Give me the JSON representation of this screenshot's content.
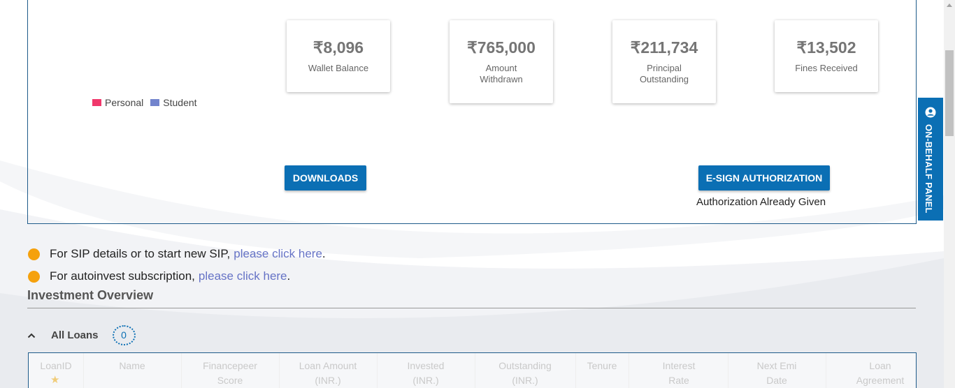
{
  "chart_data": {
    "type": "pie",
    "legend": [
      {
        "label": "Personal",
        "color": "#f0386b"
      },
      {
        "label": "Student",
        "color": "#7284cd"
      }
    ]
  },
  "stats": [
    {
      "value": "₹8,096",
      "label": "Wallet Balance"
    },
    {
      "value": "₹765,000",
      "label": "Amount Withdrawn"
    },
    {
      "value": "₹211,734",
      "label": "Principal Outstanding"
    },
    {
      "value": "₹13,502",
      "label": "Fines Received"
    }
  ],
  "buttons": {
    "downloads": "DOWNLOADS",
    "esign": "E-SIGN AUTHORIZATION"
  },
  "auth_note": "Authorization Already Given",
  "side_tab": {
    "label": "ON-BEHALF PANEL",
    "icon": "user-circle-icon"
  },
  "info": {
    "sip_text": "For SIP details or to start new SIP,",
    "sip_link": "please click here",
    "autoinvest_text": "For autoinvest subscription,",
    "autoinvest_link": "please click here",
    "period": "."
  },
  "section_title": "Investment Overview",
  "all_loans": {
    "label": "All Loans",
    "count": "0"
  },
  "table_headers": [
    {
      "line1": "LoanID",
      "line2": ""
    },
    {
      "line1": "Name",
      "line2": ""
    },
    {
      "line1": "Financepeer",
      "line2": "Score"
    },
    {
      "line1": "Loan Amount",
      "line2": "(INR.)"
    },
    {
      "line1": "Invested",
      "line2": "(INR.)"
    },
    {
      "line1": "Outstanding",
      "line2": "(INR.)"
    },
    {
      "line1": "Tenure",
      "line2": ""
    },
    {
      "line1": "Interest",
      "line2": "Rate"
    },
    {
      "line1": "Next Emi",
      "line2": "Date"
    },
    {
      "line1": "Loan",
      "line2": "Agreement"
    }
  ],
  "colors": {
    "accent": "#0b6fb4",
    "dot": "#f5a10d",
    "link": "#6673c6"
  }
}
